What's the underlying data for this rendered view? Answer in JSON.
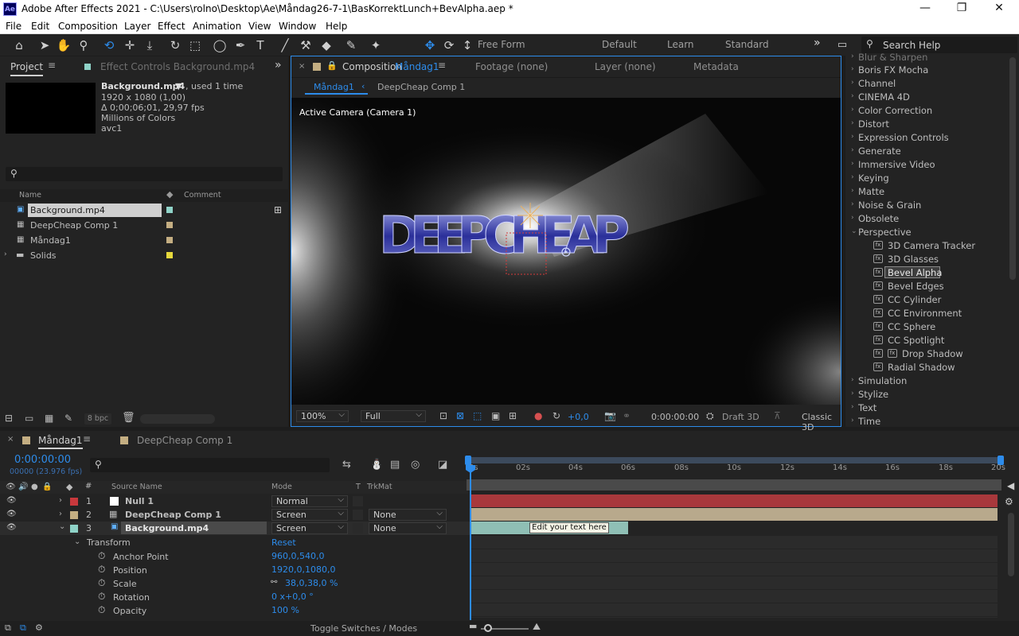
{
  "window": {
    "logo": "Ae",
    "title": "Adobe After Effects 2021 - C:\\Users\\rolno\\Desktop\\Ae\\Måndag26-7-1\\BasKorrektLunch+BevAlpha.aep *",
    "controls": [
      "—",
      "❐",
      "✕"
    ]
  },
  "menu": [
    "File",
    "Edit",
    "Composition",
    "Layer",
    "Effect",
    "Animation",
    "View",
    "Window",
    "Help"
  ],
  "toolbar": {
    "free_form": "Free Form",
    "workspaces": [
      "Default",
      "Learn",
      "Standard"
    ],
    "more": "»",
    "search_placeholder": "Search Help"
  },
  "project": {
    "tab_project": "Project",
    "tab_effect_controls": "Effect Controls Background.mp4",
    "asset_name": "Background.mp4",
    "used": ", used 1 time",
    "info": [
      "1920 x 1080 (1,00)",
      "Δ 0;00;06;01, 29,97 fps",
      "Millions of Colors",
      "avc1"
    ],
    "search_placeholder": "",
    "col_name": "Name",
    "col_comment": "Comment",
    "items": [
      {
        "name": "Background.mp4",
        "color": "#8fd3c8"
      },
      {
        "name": "DeepCheap Comp 1",
        "color": "#c4ae82"
      },
      {
        "name": "Måndag1",
        "color": "#c4ae82"
      },
      {
        "name": "Solids",
        "color": "#e6d83c"
      }
    ],
    "bpc": "8 bpc"
  },
  "composition": {
    "tab": "Composition",
    "comp_name": "Måndag1",
    "footage": "Footage (none)",
    "layer": "Layer (none)",
    "metadata": "Metadata",
    "crumbs": [
      "Måndag1",
      "DeepCheap Comp 1"
    ],
    "camera_label": "Active Camera (Camera 1)",
    "title_art": "DEEPCHEAP",
    "zoom": "100%",
    "resolution": "Full",
    "exposure": "+0,0",
    "timecode": "0:00:00:00",
    "draft": "Draft 3D",
    "renderer": "Classic 3D"
  },
  "effects": {
    "categories_top": [
      "Blur & Sharpen",
      "Boris FX Mocha",
      "Channel",
      "CINEMA 4D",
      "Color Correction",
      "Distort",
      "Expression Controls",
      "Generate",
      "Immersive Video",
      "Keying",
      "Matte",
      "Noise & Grain",
      "Obsolete",
      "Perspective"
    ],
    "perspective_items": [
      "3D Camera Tracker",
      "3D Glasses",
      "Bevel Alpha",
      "Bevel Edges",
      "CC Cylinder",
      "CC Environment",
      "CC Sphere",
      "CC Spotlight",
      "Drop Shadow",
      "Radial Shadow"
    ],
    "categories_bottom": [
      "Simulation",
      "Stylize",
      "Text",
      "Time"
    ],
    "selected": "Bevel Alpha"
  },
  "timeline": {
    "tab1": "Måndag1",
    "tab2": "DeepCheap Comp 1",
    "timecode": "0:00:00:00",
    "frame_info": "00000 (23.976 fps)",
    "col_source": "Source Name",
    "col_mode": "Mode",
    "col_t": "T",
    "col_trkmat": "TrkMat",
    "ruler": [
      "0s",
      "02s",
      "04s",
      "06s",
      "08s",
      "10s",
      "12s",
      "14s",
      "16s",
      "18s",
      "20s"
    ],
    "layers": [
      {
        "num": "1",
        "name": "Null 1",
        "mode": "Normal",
        "trkmat": "",
        "color": "#c8383c",
        "bar": "#a8383c"
      },
      {
        "num": "2",
        "name": "DeepCheap Comp 1",
        "mode": "Screen",
        "trkmat": "None",
        "color": "#c4ae82",
        "bar": "#b8a98c"
      },
      {
        "num": "3",
        "name": "Background.mp4",
        "mode": "Screen",
        "trkmat": "None",
        "color": "#8fd3c8",
        "bar": "#8fbfb5"
      }
    ],
    "transform": {
      "label": "Transform",
      "reset": "Reset",
      "props": [
        {
          "name": "Anchor Point",
          "value": "960,0,540,0"
        },
        {
          "name": "Position",
          "value": "1920,0,1080,0"
        },
        {
          "name": "Scale",
          "value": "38,0,38,0 %"
        },
        {
          "name": "Rotation",
          "value": "0 x+0,0 °"
        },
        {
          "name": "Opacity",
          "value": "100 %"
        }
      ]
    },
    "tooltip": "Edit your text here",
    "toggle": "Toggle Switches / Modes"
  }
}
